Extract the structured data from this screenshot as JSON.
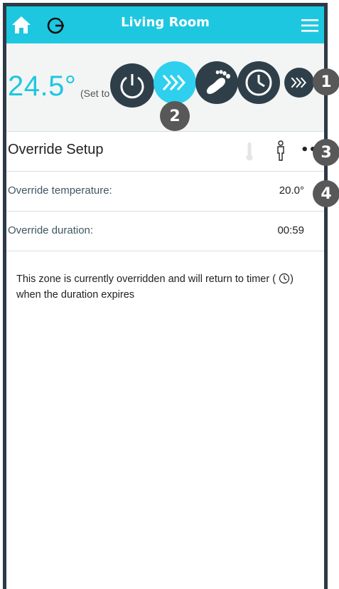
{
  "header": {
    "title": "Living Room",
    "left_icons": [
      "home-icon",
      "refresh-icon"
    ],
    "right_icon": "menu-icon",
    "colors": {
      "bar": "#1ec7e0",
      "text": "#ffffff"
    }
  },
  "status": {
    "current_temp": "24.5°",
    "set_prefix": "(Set to"
  },
  "modes": [
    {
      "name": "off",
      "icon": "power-icon",
      "active": false
    },
    {
      "name": "override",
      "icon": "override-chevrons-icon",
      "active": true
    },
    {
      "name": "footprint",
      "icon": "footprint-icon",
      "active": false
    },
    {
      "name": "timer",
      "icon": "clock-icon",
      "active": false
    },
    {
      "name": "override-small",
      "icon": "override-chevrons-icon",
      "active": false
    }
  ],
  "badges": {
    "b1": "1",
    "b2": "2",
    "b3": "3",
    "b4": "4"
  },
  "section": {
    "title": "Override Setup",
    "icons": [
      "thermometer-icon",
      "person-icon",
      "more-icon"
    ],
    "more_label": "•••"
  },
  "rows": [
    {
      "label": "Override temperature:",
      "value": "20.0°"
    },
    {
      "label": "Override duration:",
      "value": "00:59"
    }
  ],
  "info": {
    "text_before": "This zone is currently overridden and will return to timer (",
    "text_after": ") when the duration expires"
  }
}
